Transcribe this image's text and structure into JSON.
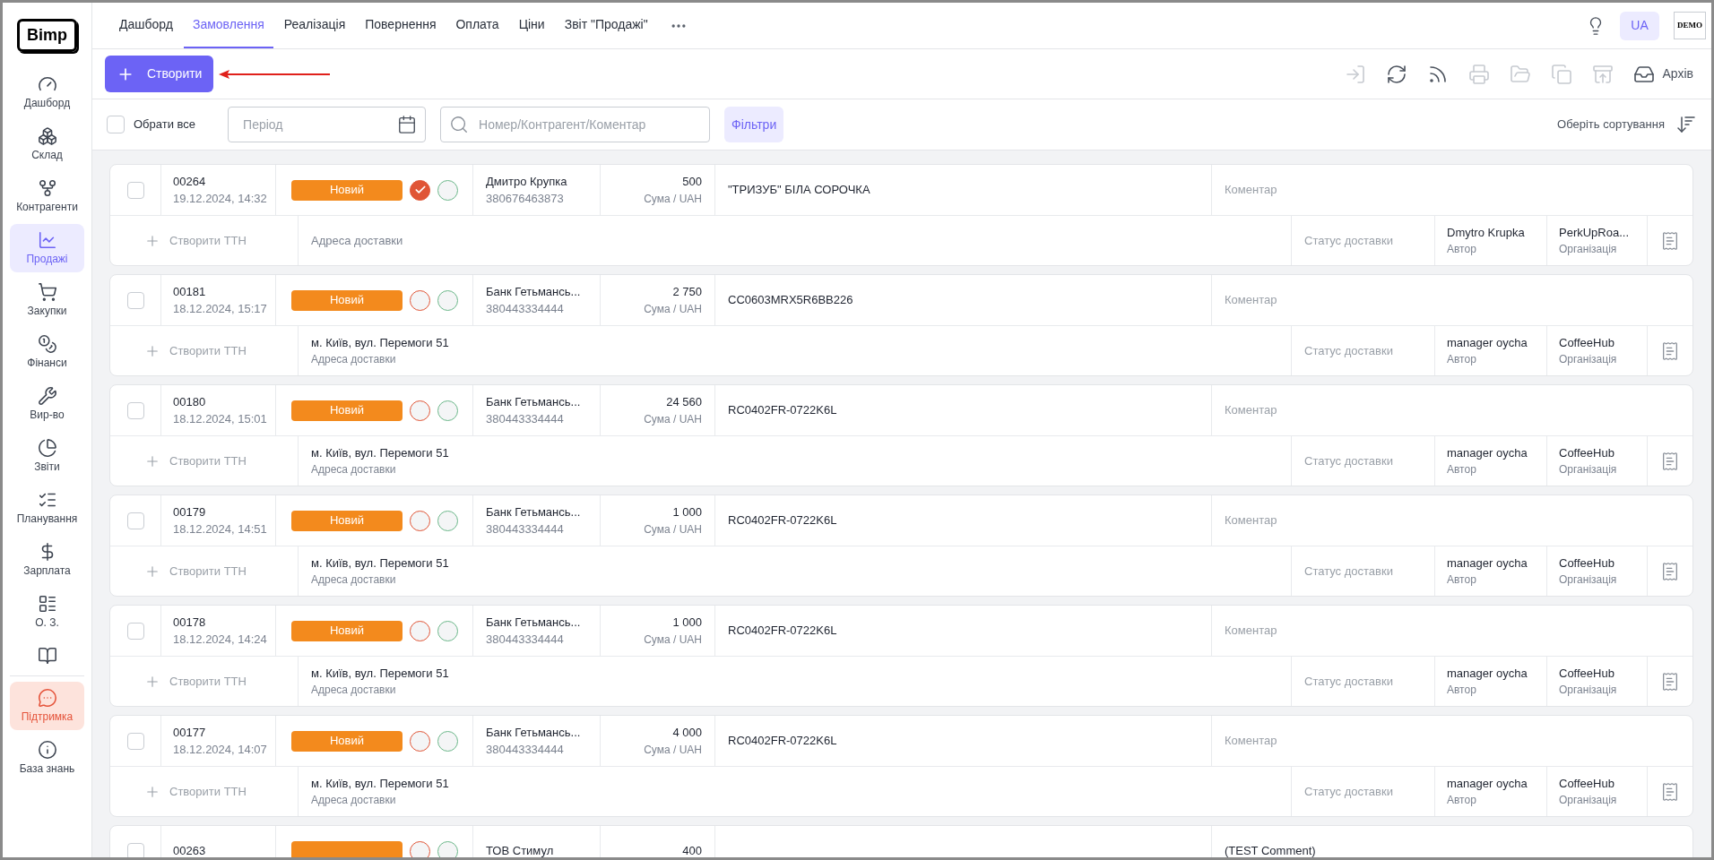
{
  "logo": "Bimp",
  "sidebar": {
    "items": [
      {
        "label": "Дашборд",
        "selected": false,
        "kind": "nav"
      },
      {
        "label": "Склад",
        "selected": false,
        "kind": "nav"
      },
      {
        "label": "Контрагенти",
        "selected": false,
        "kind": "nav"
      },
      {
        "label": "Продажі",
        "selected": true,
        "kind": "nav"
      },
      {
        "label": "Закупки",
        "selected": false,
        "kind": "nav"
      },
      {
        "label": "Фінанси",
        "selected": false,
        "kind": "nav"
      },
      {
        "label": "Вир-во",
        "selected": false,
        "kind": "nav"
      },
      {
        "label": "Звіти",
        "selected": false,
        "kind": "nav"
      },
      {
        "label": "Планування",
        "selected": false,
        "kind": "nav"
      },
      {
        "label": "Зарплата",
        "selected": false,
        "kind": "nav"
      },
      {
        "label": "О. З.",
        "selected": false,
        "kind": "nav"
      },
      {
        "selected": false,
        "kind": "nav"
      },
      {
        "label": "Підтримка",
        "selected": false,
        "kind": "support"
      },
      {
        "label": "База знань",
        "selected": false,
        "kind": "nav"
      }
    ]
  },
  "tabs": [
    {
      "label": "Дашборд",
      "selected": false
    },
    {
      "label": "Замовлення",
      "selected": true
    },
    {
      "label": "Реалізація",
      "selected": false
    },
    {
      "label": "Повернення",
      "selected": false
    },
    {
      "label": "Оплата",
      "selected": false
    },
    {
      "label": "Ціни",
      "selected": false
    },
    {
      "label": "Звіт \"Продажі\"",
      "selected": false
    }
  ],
  "language": "UA",
  "demo_badge": "DEMO",
  "create_button": "Створити",
  "toolbar": [
    {
      "disabled": true
    },
    {
      "disabled": false
    },
    {
      "disabled": false
    },
    {
      "disabled": true
    },
    {
      "disabled": true
    },
    {
      "disabled": true
    },
    {
      "disabled": true
    }
  ],
  "archive_button": "Архів",
  "filters": {
    "select_all": {
      "label": "Обрати все",
      "checked": false
    },
    "period": {
      "placeholder": "Період"
    },
    "search": {
      "placeholder": "Номер/Контрагент/Коментар"
    },
    "filters_button": "Фільтри",
    "sort": "Оберіть сортування"
  },
  "orders": [
    {
      "checked": false,
      "number": "00264",
      "date": "19.12.2024, 14:32",
      "status": "Новий",
      "paid": true,
      "shipped": false,
      "client": "Дмитро Крупка",
      "phone": "380676463873",
      "amount": "500",
      "amount_label": "Сума / UAH",
      "product": "\"ТРИЗУБ\" БІЛА СОРОЧКА",
      "comment_placeholder": "Коментар",
      "ttn": "Створити ТТН",
      "address_label": "Адреса доставки",
      "delivery_status": "Статус доставки",
      "author": "Dmytro Krupka",
      "author_label": "Автор",
      "org": "PerkUpRoa...",
      "org_label": "Організація"
    },
    {
      "checked": false,
      "number": "00181",
      "date": "18.12.2024, 15:17",
      "status": "Новий",
      "paid": false,
      "shipped": false,
      "client": "Банк Гетьмансь...",
      "phone": "380443334444",
      "amount": "2 750",
      "amount_label": "Сума / UAH",
      "product": "CC0603MRX5R6BB226",
      "comment_placeholder": "Коментар",
      "ttn": "Створити ТТН",
      "address": "м. Київ, вул. Перемоги 51",
      "address_label": "Адреса доставки",
      "delivery_status": "Статус доставки",
      "author": "manager oycha",
      "author_label": "Автор",
      "org": "CoffeeHub",
      "org_label": "Організація"
    },
    {
      "checked": false,
      "number": "00180",
      "date": "18.12.2024, 15:01",
      "status": "Новий",
      "paid": false,
      "shipped": false,
      "client": "Банк Гетьмансь...",
      "phone": "380443334444",
      "amount": "24 560",
      "amount_label": "Сума / UAH",
      "product": "RC0402FR-0722K6L",
      "comment_placeholder": "Коментар",
      "ttn": "Створити ТТН",
      "address": "м. Київ, вул. Перемоги 51",
      "address_label": "Адреса доставки",
      "delivery_status": "Статус доставки",
      "author": "manager oycha",
      "author_label": "Автор",
      "org": "CoffeeHub",
      "org_label": "Організація"
    },
    {
      "checked": false,
      "number": "00179",
      "date": "18.12.2024, 14:51",
      "status": "Новий",
      "paid": false,
      "shipped": false,
      "client": "Банк Гетьмансь...",
      "phone": "380443334444",
      "amount": "1 000",
      "amount_label": "Сума / UAH",
      "product": "RC0402FR-0722K6L",
      "comment_placeholder": "Коментар",
      "ttn": "Створити ТТН",
      "address": "м. Київ, вул. Перемоги 51",
      "address_label": "Адреса доставки",
      "delivery_status": "Статус доставки",
      "author": "manager oycha",
      "author_label": "Автор",
      "org": "CoffeeHub",
      "org_label": "Організація"
    },
    {
      "checked": false,
      "number": "00178",
      "date": "18.12.2024, 14:24",
      "status": "Новий",
      "paid": false,
      "shipped": false,
      "client": "Банк Гетьмансь...",
      "phone": "380443334444",
      "amount": "1 000",
      "amount_label": "Сума / UAH",
      "product": "RC0402FR-0722K6L",
      "comment_placeholder": "Коментар",
      "ttn": "Створити ТТН",
      "address": "м. Київ, вул. Перемоги 51",
      "address_label": "Адреса доставки",
      "delivery_status": "Статус доставки",
      "author": "manager oycha",
      "author_label": "Автор",
      "org": "CoffeeHub",
      "org_label": "Організація"
    },
    {
      "checked": false,
      "number": "00177",
      "date": "18.12.2024, 14:07",
      "status": "Новий",
      "paid": false,
      "shipped": false,
      "client": "Банк Гетьмансь...",
      "phone": "380443334444",
      "amount": "4 000",
      "amount_label": "Сума / UAH",
      "product": "RC0402FR-0722K6L",
      "comment_placeholder": "Коментар",
      "ttn": "Створити ТТН",
      "address": "м. Київ, вул. Перемоги 51",
      "address_label": "Адреса доставки",
      "delivery_status": "Статус доставки",
      "author": "manager oycha",
      "author_label": "Автор",
      "org": "CoffeeHub",
      "org_label": "Організація"
    },
    {
      "checked": false,
      "number": "00263",
      "paid": false,
      "shipped": false,
      "client": "ТОВ Стимул",
      "amount": "400",
      "comment": "(TEST Comment)"
    }
  ]
}
